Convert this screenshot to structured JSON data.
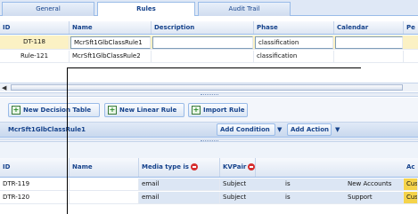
{
  "tabs": [
    "General",
    "Rules",
    "Audit Trail"
  ],
  "top_grid": {
    "columns": [
      "ID",
      "Name",
      "Description",
      "Phase",
      "Calendar",
      "Pe"
    ],
    "rows": [
      {
        "id": "DT-118",
        "name": "McrSft1GlbClassRule1",
        "description": "",
        "phase": "classification",
        "calendar": ""
      },
      {
        "id": "Rule-121",
        "name": "McrSft1GlbClassRule2",
        "description": "",
        "phase": "classification",
        "calendar": ""
      }
    ]
  },
  "toolbar": {
    "new_decision_table": "New Decision Table",
    "new_linear_rule": "New Linear Rule",
    "import_rule": "Import Rule"
  },
  "rule_bar": {
    "title": "McrSft1GlbClassRule1",
    "add_condition": "Add Condition",
    "add_action": "Add Action"
  },
  "bottom_grid": {
    "columns": [
      "ID",
      "Name",
      "Media type is",
      "KVPair",
      "Ac"
    ],
    "rows": [
      {
        "id": "DTR-119",
        "name": "",
        "media": "email",
        "key": "Subject",
        "op": "is",
        "value": "New Accounts",
        "action": "Cus"
      },
      {
        "id": "DTR-120",
        "name": "",
        "media": "email",
        "key": "Subject",
        "op": "is",
        "value": "Support",
        "action": "Cus"
      }
    ]
  },
  "colors": {
    "selection": "#fbf1c4",
    "header_text": "#15428b",
    "border": "#99bbe8",
    "action_cell": "#f5d34a"
  }
}
